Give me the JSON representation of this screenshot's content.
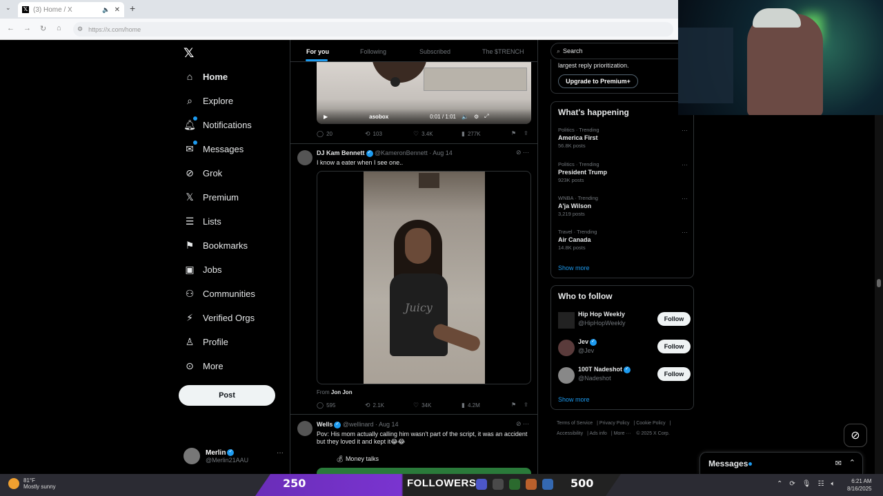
{
  "browser": {
    "tab_title": "(3) Home / X",
    "url": "https://x.com/home",
    "tab_icon": "x-logo-icon"
  },
  "nav": {
    "items": [
      {
        "label": "Home",
        "icon": "home-icon"
      },
      {
        "label": "Explore",
        "icon": "search-icon"
      },
      {
        "label": "Notifications",
        "icon": "bell-icon"
      },
      {
        "label": "Messages",
        "icon": "mail-icon"
      },
      {
        "label": "Grok",
        "icon": "grok-icon"
      },
      {
        "label": "Premium",
        "icon": "x-logo-icon"
      },
      {
        "label": "Lists",
        "icon": "list-icon"
      },
      {
        "label": "Bookmarks",
        "icon": "bookmark-icon"
      },
      {
        "label": "Jobs",
        "icon": "briefcase-icon"
      },
      {
        "label": "Communities",
        "icon": "people-icon"
      },
      {
        "label": "Verified Orgs",
        "icon": "lightning-icon"
      },
      {
        "label": "Profile",
        "icon": "person-icon"
      },
      {
        "label": "More",
        "icon": "more-circle-icon"
      }
    ],
    "post_label": "Post",
    "profile": {
      "name": "Merlin",
      "handle": "@Merlin21AAU"
    }
  },
  "feed": {
    "tabs": [
      "For you",
      "Following",
      "Subscribed",
      "The $TRENCH"
    ],
    "tweet0": {
      "video_time": "0:01 / 1:01",
      "watermark": "asobox",
      "replies": "20",
      "reposts": "103",
      "likes": "3.4K",
      "views": "277K"
    },
    "tweet1": {
      "name": "DJ Kam Bennett",
      "handle": "@KameronBennett",
      "date": "· Aug 14",
      "text": "I know a eater when I see one..",
      "shirt_text": "Juicy",
      "from_prefix": "From",
      "from_name": "Jon Jon",
      "replies": "595",
      "reposts": "2.1K",
      "likes": "34K",
      "views": "4.2M"
    },
    "tweet2": {
      "name": "Wells",
      "handle": "@wellinard",
      "date": "· Aug 14",
      "text": "Pov: His mom actually calling him wasn't part of the script, it was an accident but they loved it and kept it😂😂",
      "quote": "Money talks"
    }
  },
  "sidebar": {
    "search_placeholder": "Search",
    "premium_text": "largest reply prioritization.",
    "premium_button": "Upgrade to Premium+",
    "happening_title": "What's happening",
    "trends": [
      {
        "category": "Politics · Trending",
        "name": "America First",
        "count": "56.8K posts"
      },
      {
        "category": "Politics · Trending",
        "name": "President Trump",
        "count": "923K posts"
      },
      {
        "category": "WNBA · Trending",
        "name": "A'ja Wilson",
        "count": "3,219 posts"
      },
      {
        "category": "Travel · Trending",
        "name": "Air Canada",
        "count": "14.8K posts"
      }
    ],
    "show_more": "Show more",
    "wtf_title": "Who to follow",
    "follow_label": "Follow",
    "wtf": [
      {
        "name": "Hip Hop Weekly",
        "handle": "@HipHopWeekly"
      },
      {
        "name": "Jev",
        "handle": "@Jev"
      },
      {
        "name": "100T Nadeshot",
        "handle": "@Nadeshot"
      }
    ],
    "footer": [
      "Terms of Service",
      "Privacy Policy",
      "Cookie Policy",
      "Accessibility",
      "Ads info",
      "More ···",
      "© 2025 X Corp."
    ]
  },
  "messages_drawer": {
    "label": "Messages"
  },
  "taskbar": {
    "temp": "81°F",
    "weather": "Mostly sunny",
    "goal_start": "250",
    "goal_label": "FOLLOWERS",
    "goal_end": "500",
    "goal_progress": 0.4,
    "time": "6:21 AM",
    "date": "8/16/2025"
  }
}
